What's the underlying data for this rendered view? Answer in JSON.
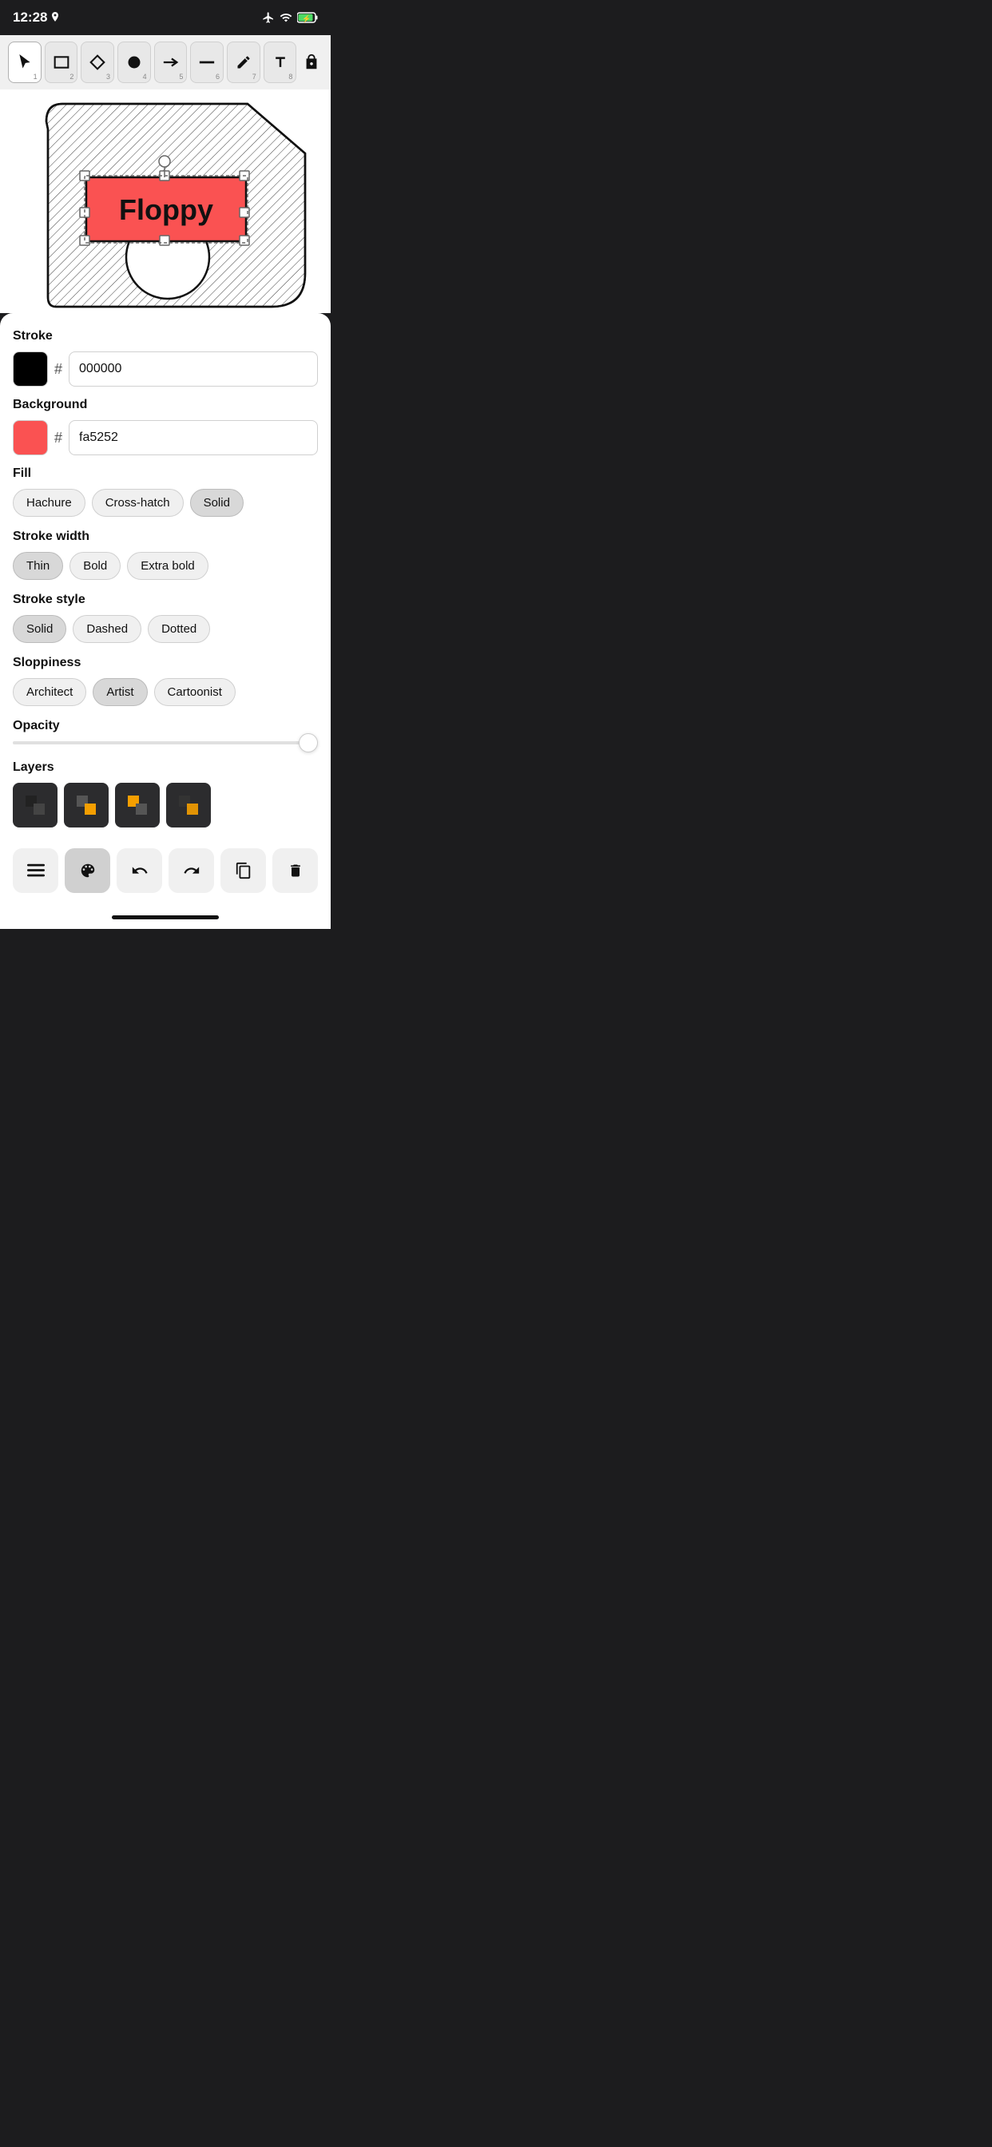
{
  "statusBar": {
    "time": "12:28",
    "locationIcon": true
  },
  "toolbar": {
    "tools": [
      {
        "id": "select",
        "icon": "cursor",
        "num": "1",
        "active": true
      },
      {
        "id": "rect",
        "icon": "rect",
        "num": "2",
        "active": false
      },
      {
        "id": "diamond",
        "icon": "diamond",
        "num": "3",
        "active": false
      },
      {
        "id": "circle",
        "icon": "circle",
        "num": "4",
        "active": false
      },
      {
        "id": "arrow",
        "icon": "arrow",
        "num": "5",
        "active": false
      },
      {
        "id": "line",
        "icon": "line",
        "num": "6",
        "active": false
      },
      {
        "id": "pen",
        "icon": "pen",
        "num": "7",
        "active": false
      },
      {
        "id": "text",
        "icon": "text",
        "num": "8",
        "active": false
      }
    ]
  },
  "canvas": {
    "label": "drawing canvas"
  },
  "panel": {
    "stroke": {
      "label": "Stroke",
      "color": "#000000",
      "hex": "000000"
    },
    "background": {
      "label": "Background",
      "color": "#fa5252",
      "hex": "fa5252"
    },
    "fill": {
      "label": "Fill",
      "options": [
        "Hachure",
        "Cross-hatch",
        "Solid"
      ],
      "active": "Solid"
    },
    "strokeWidth": {
      "label": "Stroke width",
      "options": [
        "Thin",
        "Bold",
        "Extra bold"
      ],
      "active": "Thin"
    },
    "strokeStyle": {
      "label": "Stroke style",
      "options": [
        "Solid",
        "Dashed",
        "Dotted"
      ],
      "active": "Solid"
    },
    "sloppiness": {
      "label": "Sloppiness",
      "options": [
        "Architect",
        "Artist",
        "Cartoonist"
      ],
      "active": "Artist"
    },
    "opacity": {
      "label": "Opacity",
      "value": 100
    },
    "layers": {
      "label": "Layers",
      "items": [
        {
          "id": "layer1",
          "icon": "layers-black"
        },
        {
          "id": "layer2",
          "icon": "layers-orange"
        },
        {
          "id": "layer3",
          "icon": "layers-multi"
        },
        {
          "id": "layer4",
          "icon": "layers-orange2"
        }
      ]
    },
    "actions": [
      {
        "id": "menu",
        "icon": "≡"
      },
      {
        "id": "style",
        "icon": "palette",
        "active": true
      },
      {
        "id": "undo",
        "icon": "undo"
      },
      {
        "id": "redo",
        "icon": "redo"
      },
      {
        "id": "copy",
        "icon": "copy"
      },
      {
        "id": "delete",
        "icon": "trash"
      }
    ]
  }
}
